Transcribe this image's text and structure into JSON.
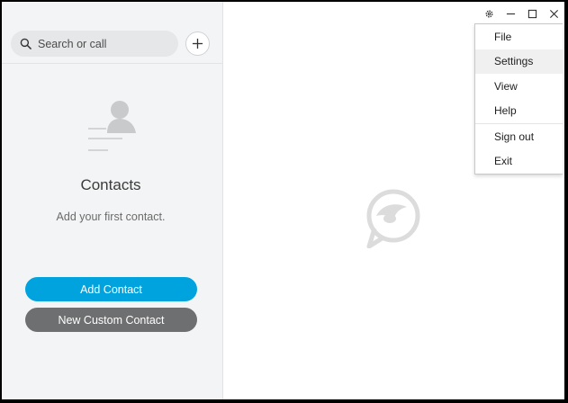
{
  "sidebar": {
    "search": {
      "placeholder": "Search or call",
      "icon": "search-icon"
    },
    "add_icon": "plus-icon",
    "empty_state": {
      "title": "Contacts",
      "subtitle": "Add your first contact."
    },
    "buttons": {
      "add_contact": "Add Contact",
      "new_custom_contact": "New Custom Contact"
    }
  },
  "titlebar": {
    "icons": [
      "gear-icon",
      "minimize-icon",
      "maximize-icon",
      "close-icon"
    ]
  },
  "menu": {
    "items": [
      {
        "label": "File"
      },
      {
        "label": "Settings",
        "highlighted": true
      },
      {
        "label": "View"
      },
      {
        "label": "Help"
      },
      {
        "label": "Sign out"
      },
      {
        "label": "Exit"
      }
    ]
  },
  "colors": {
    "accent": "#00a3dd",
    "secondary_button": "#6e6f70",
    "sidebar_bg": "#f3f4f5"
  }
}
